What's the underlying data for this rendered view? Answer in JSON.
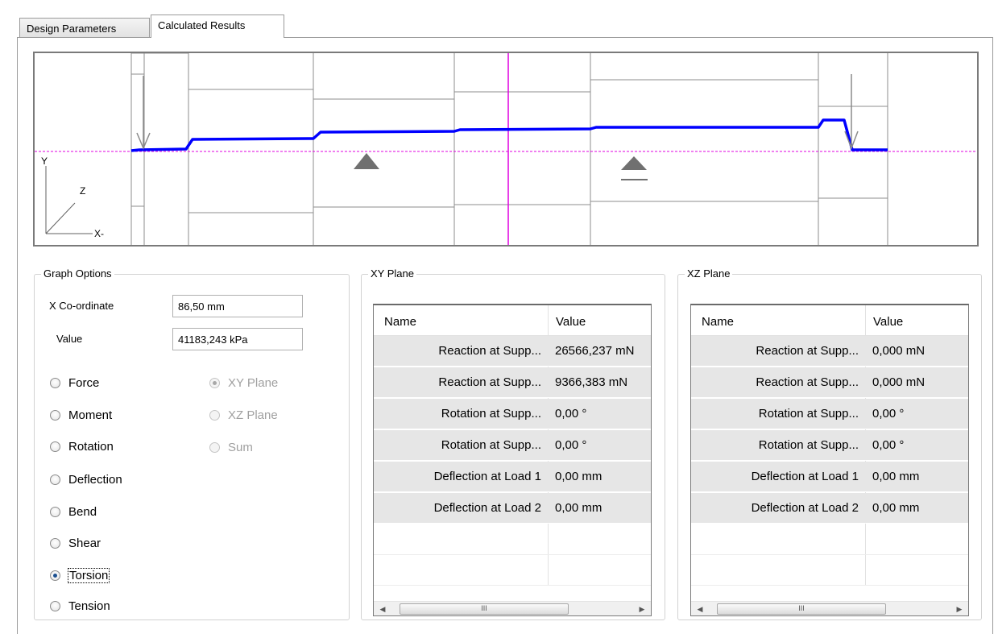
{
  "tabs": [
    {
      "label": "Design Parameters",
      "active": false
    },
    {
      "label": "Calculated Results",
      "active": true
    }
  ],
  "graph": {
    "axis_y": "Y",
    "axis_z": "Z",
    "axis_x": "X-",
    "curve_color": "#0000ff",
    "cursor_color": "#e000e0"
  },
  "graph_options": {
    "title": "Graph Options",
    "x_coordinate_label": "X Co-ordinate",
    "x_coordinate_value": "86,50 mm",
    "value_label": "Value",
    "value_value": "41183,243 kPa",
    "quantities": [
      {
        "label": "Force",
        "checked": false
      },
      {
        "label": "Moment",
        "checked": false
      },
      {
        "label": "Rotation",
        "checked": false
      },
      {
        "label": "Deflection",
        "checked": false
      },
      {
        "label": "Bend",
        "checked": false
      },
      {
        "label": "Shear",
        "checked": false
      },
      {
        "label": "Torsion",
        "checked": true
      },
      {
        "label": "Tension",
        "checked": false
      }
    ],
    "planes": [
      {
        "label": "XY Plane",
        "checked": true
      },
      {
        "label": "XZ Plane",
        "checked": false
      },
      {
        "label": "Sum",
        "checked": false
      }
    ]
  },
  "xy_plane": {
    "title": "XY Plane",
    "col_name": "Name",
    "col_value": "Value",
    "rows": [
      {
        "name": "Reaction at Supp...",
        "value": "26566,237 mN"
      },
      {
        "name": "Reaction at Supp...",
        "value": "9366,383 mN"
      },
      {
        "name": "Rotation at Supp...",
        "value": "0,00 °"
      },
      {
        "name": "Rotation at Supp...",
        "value": "0,00 °"
      },
      {
        "name": "Deflection at Load 1",
        "value": "0,00 mm"
      },
      {
        "name": "Deflection at Load 2",
        "value": "0,00 mm"
      }
    ],
    "scroll_thumb": "III"
  },
  "xz_plane": {
    "title": "XZ Plane",
    "col_name": "Name",
    "col_value": "Value",
    "rows": [
      {
        "name": "Reaction at Supp...",
        "value": "0,000 mN"
      },
      {
        "name": "Reaction at Supp...",
        "value": "0,000 mN"
      },
      {
        "name": "Rotation at Supp...",
        "value": "0,00 °"
      },
      {
        "name": "Rotation at Supp...",
        "value": "0,00 °"
      },
      {
        "name": "Deflection at Load 1",
        "value": "0,00 mm"
      },
      {
        "name": "Deflection at Load 2",
        "value": "0,00 mm"
      }
    ],
    "scroll_thumb": "III"
  }
}
